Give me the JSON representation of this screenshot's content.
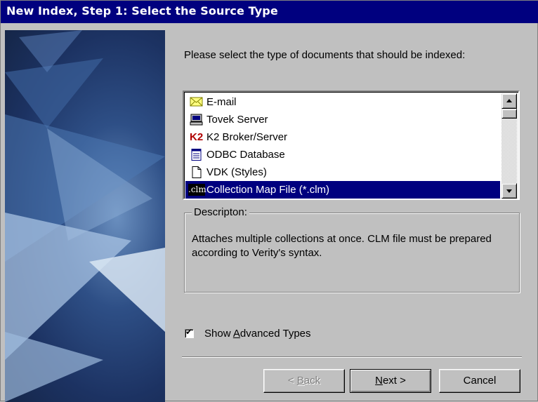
{
  "window": {
    "title": "New Index, Step 1: Select the Source Type"
  },
  "prompt": "Please select the type of documents that should be indexed:",
  "source_types": [
    {
      "label": "E-mail",
      "icon": "envelope-icon",
      "selected": false
    },
    {
      "label": "Tovek Server",
      "icon": "computer-icon",
      "selected": false
    },
    {
      "label": "K2 Broker/Server",
      "icon": "k2-icon",
      "icon_text": "K2",
      "selected": false
    },
    {
      "label": "ODBC Database",
      "icon": "database-icon",
      "selected": false
    },
    {
      "label": "VDK (Styles)",
      "icon": "document-icon",
      "selected": false
    },
    {
      "label": "Collection Map File (*.clm)",
      "icon": "clm-icon",
      "icon_text": ".clm",
      "selected": true
    }
  ],
  "description": {
    "legend": "Descripton:",
    "text": "Attaches multiple collections at once. CLM file must be prepared according to Verity's syntax."
  },
  "show_advanced": {
    "label_pre": "Show ",
    "label_accel": "A",
    "label_post": "dvanced Types",
    "checked": true,
    "check_mark": "✔"
  },
  "buttons": {
    "back": {
      "pre": "< ",
      "accel": "B",
      "post": "ack",
      "enabled": false
    },
    "next": {
      "pre": "",
      "accel": "N",
      "post": "ext >",
      "enabled": true
    },
    "cancel": {
      "label": "Cancel",
      "enabled": true
    }
  },
  "colors": {
    "title_bar": "#00007f",
    "selection": "#00007f",
    "dialog_face": "#c0c0c0"
  }
}
